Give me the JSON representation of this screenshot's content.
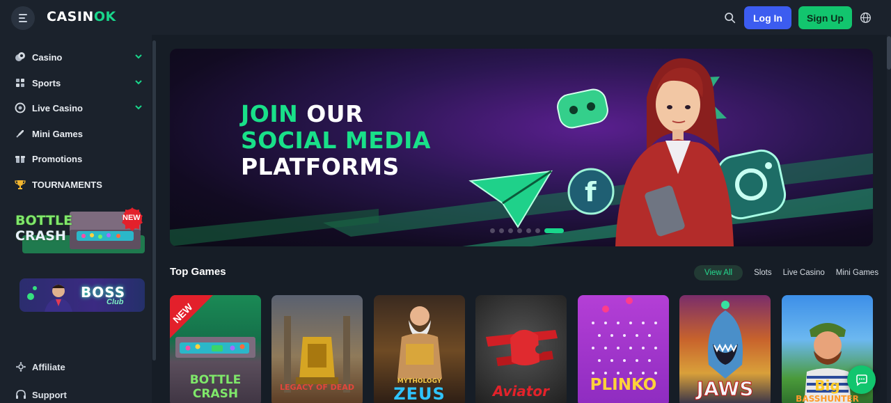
{
  "header": {
    "logo_main": "CASIN",
    "logo_accent": "OK",
    "login_label": "Log In",
    "signup_label": "Sign Up"
  },
  "sidebar": {
    "items": [
      {
        "label": "Casino",
        "icon": "casino-chips-icon",
        "expandable": true
      },
      {
        "label": "Sports",
        "icon": "sports-icon",
        "expandable": true
      },
      {
        "label": "Live Casino",
        "icon": "live-casino-icon",
        "expandable": true
      },
      {
        "label": "Mini Games",
        "icon": "rocket-icon",
        "expandable": false
      },
      {
        "label": "Promotions",
        "icon": "gift-icon",
        "expandable": false
      },
      {
        "label": "TOURNAMENTS",
        "icon": "trophy-icon",
        "expandable": false
      }
    ],
    "promo1": {
      "title_a": "BOTTLE",
      "title_b": "CRASH",
      "badge": "NEW"
    },
    "promo2": {
      "title": "BOSS",
      "subtitle": "Club"
    },
    "footer": [
      {
        "label": "Affiliate",
        "icon": "affiliate-icon"
      },
      {
        "label": "Support",
        "icon": "headset-icon"
      }
    ]
  },
  "banner": {
    "line1_green": "JOIN",
    "line1_white": " OUR",
    "line2": "SOCIAL MEDIA",
    "line3": "PLATFORMS",
    "slides": 7,
    "active_slide": 6
  },
  "top_games": {
    "title": "Top Games",
    "filters": [
      "View All",
      "Slots",
      "Live Casino",
      "Mini Games"
    ],
    "active_filter": "View All",
    "games": [
      {
        "title": "BOTTLE CRASH",
        "badge": "NEW"
      },
      {
        "title": "LEGACY OF DEAD"
      },
      {
        "title": "ZEUS",
        "subtitle": "MYTHOLOGY"
      },
      {
        "title": "Aviator"
      },
      {
        "title": "PLINKO"
      },
      {
        "title": "JAWS"
      },
      {
        "title": "BASSHUNTER",
        "subtitle": "Big"
      }
    ]
  },
  "colors": {
    "accent_green": "#12c56e",
    "login_blue": "#3c5cf0",
    "background": "#161d26"
  }
}
